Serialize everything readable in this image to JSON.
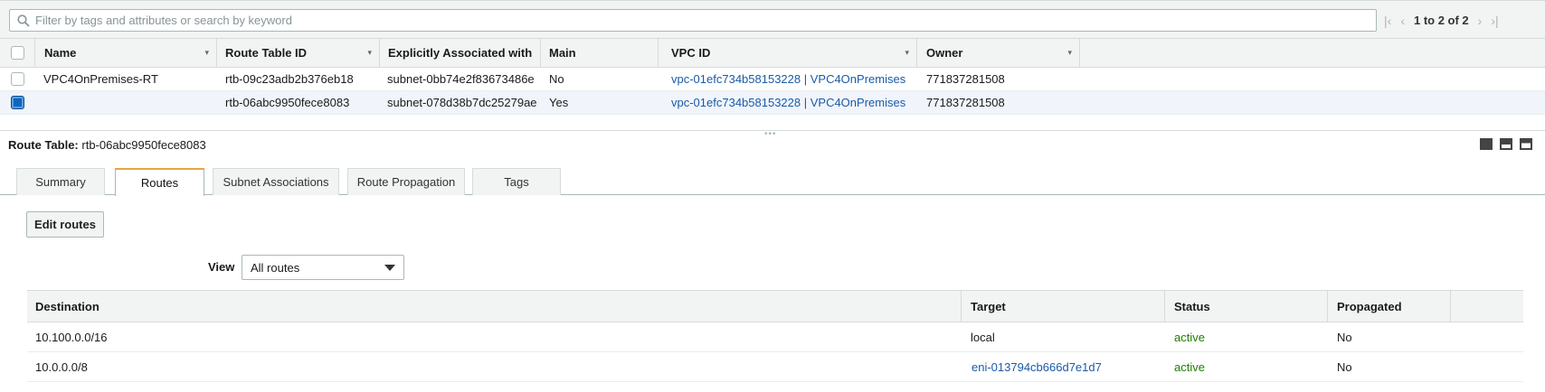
{
  "filter": {
    "placeholder": "Filter by tags and attributes or search by keyword"
  },
  "pagination": {
    "text": "1 to 2 of 2"
  },
  "route_tables": {
    "columns": [
      "Name",
      "Route Table ID",
      "Explicitly Associated with",
      "Main",
      "VPC ID",
      "Owner"
    ],
    "rows": [
      {
        "name": "VPC4OnPremises-RT",
        "id": "rtb-09c23adb2b376eb18",
        "assoc": "subnet-0bb74e2f83673486e",
        "main": "No",
        "vpc": "vpc-01efc734b58153228 | VPC4OnPremises",
        "owner": "771837281508",
        "selected": false
      },
      {
        "name": "",
        "id": "rtb-06abc9950fece8083",
        "assoc": "subnet-078d38b7dc25279ae",
        "main": "Yes",
        "vpc": "vpc-01efc734b58153228 | VPC4OnPremises",
        "owner": "771837281508",
        "selected": true
      }
    ]
  },
  "detail": {
    "label": "Route Table:",
    "value": "rtb-06abc9950fece8083",
    "tabs": [
      "Summary",
      "Routes",
      "Subnet Associations",
      "Route Propagation",
      "Tags"
    ],
    "active_tab": "Routes",
    "edit_button": "Edit routes",
    "view_label": "View",
    "view_value": "All routes"
  },
  "routes": {
    "columns": [
      "Destination",
      "Target",
      "Status",
      "Propagated"
    ],
    "rows": [
      {
        "destination": "10.100.0.0/16",
        "target": "local",
        "status": "active",
        "propagated": "No"
      },
      {
        "destination": "10.0.0.0/8",
        "target": "eni-013794cb666d7e1d7",
        "status": "active",
        "propagated": "No"
      }
    ]
  },
  "colors": {
    "link": "#1a5ba6",
    "active_status": "#1d8102",
    "tab_accent": "#e7a541",
    "selected_row": "#f1f5fb"
  }
}
